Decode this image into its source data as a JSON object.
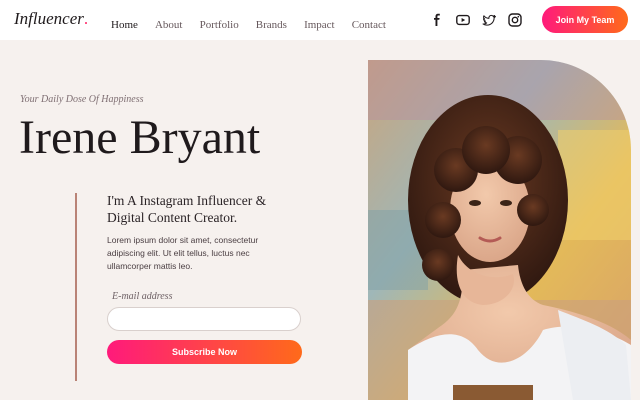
{
  "header": {
    "logo_text": "Influencer",
    "logo_dot": ".",
    "nav": [
      {
        "label": "Home",
        "active": true
      },
      {
        "label": "About",
        "active": false
      },
      {
        "label": "Portfolio",
        "active": false
      },
      {
        "label": "Brands",
        "active": false
      },
      {
        "label": "Impact",
        "active": false
      },
      {
        "label": "Contact",
        "active": false
      }
    ],
    "social_icons": [
      "facebook-icon",
      "youtube-icon",
      "twitter-icon",
      "instagram-icon"
    ],
    "join_button": "Join My Team"
  },
  "hero": {
    "eyebrow": "Your Daily Dose Of Happiness",
    "title": "Irene Bryant",
    "subheading": "I'm A Instagram Influencer & Digital Content Creator.",
    "body": "Lorem ipsum dolor sit amet, consectetur adipiscing elit. Ut elit tellus, luctus nec ullamcorper mattis leo.",
    "email_label": "E-mail address",
    "email_placeholder": "",
    "subscribe_button": "Subscribe Now",
    "photo": "portrait-photo"
  },
  "colors": {
    "accent_start": "#ff1a7b",
    "accent_end": "#ff6a1a",
    "background": "#f6f1ee",
    "divider": "#b98376"
  }
}
